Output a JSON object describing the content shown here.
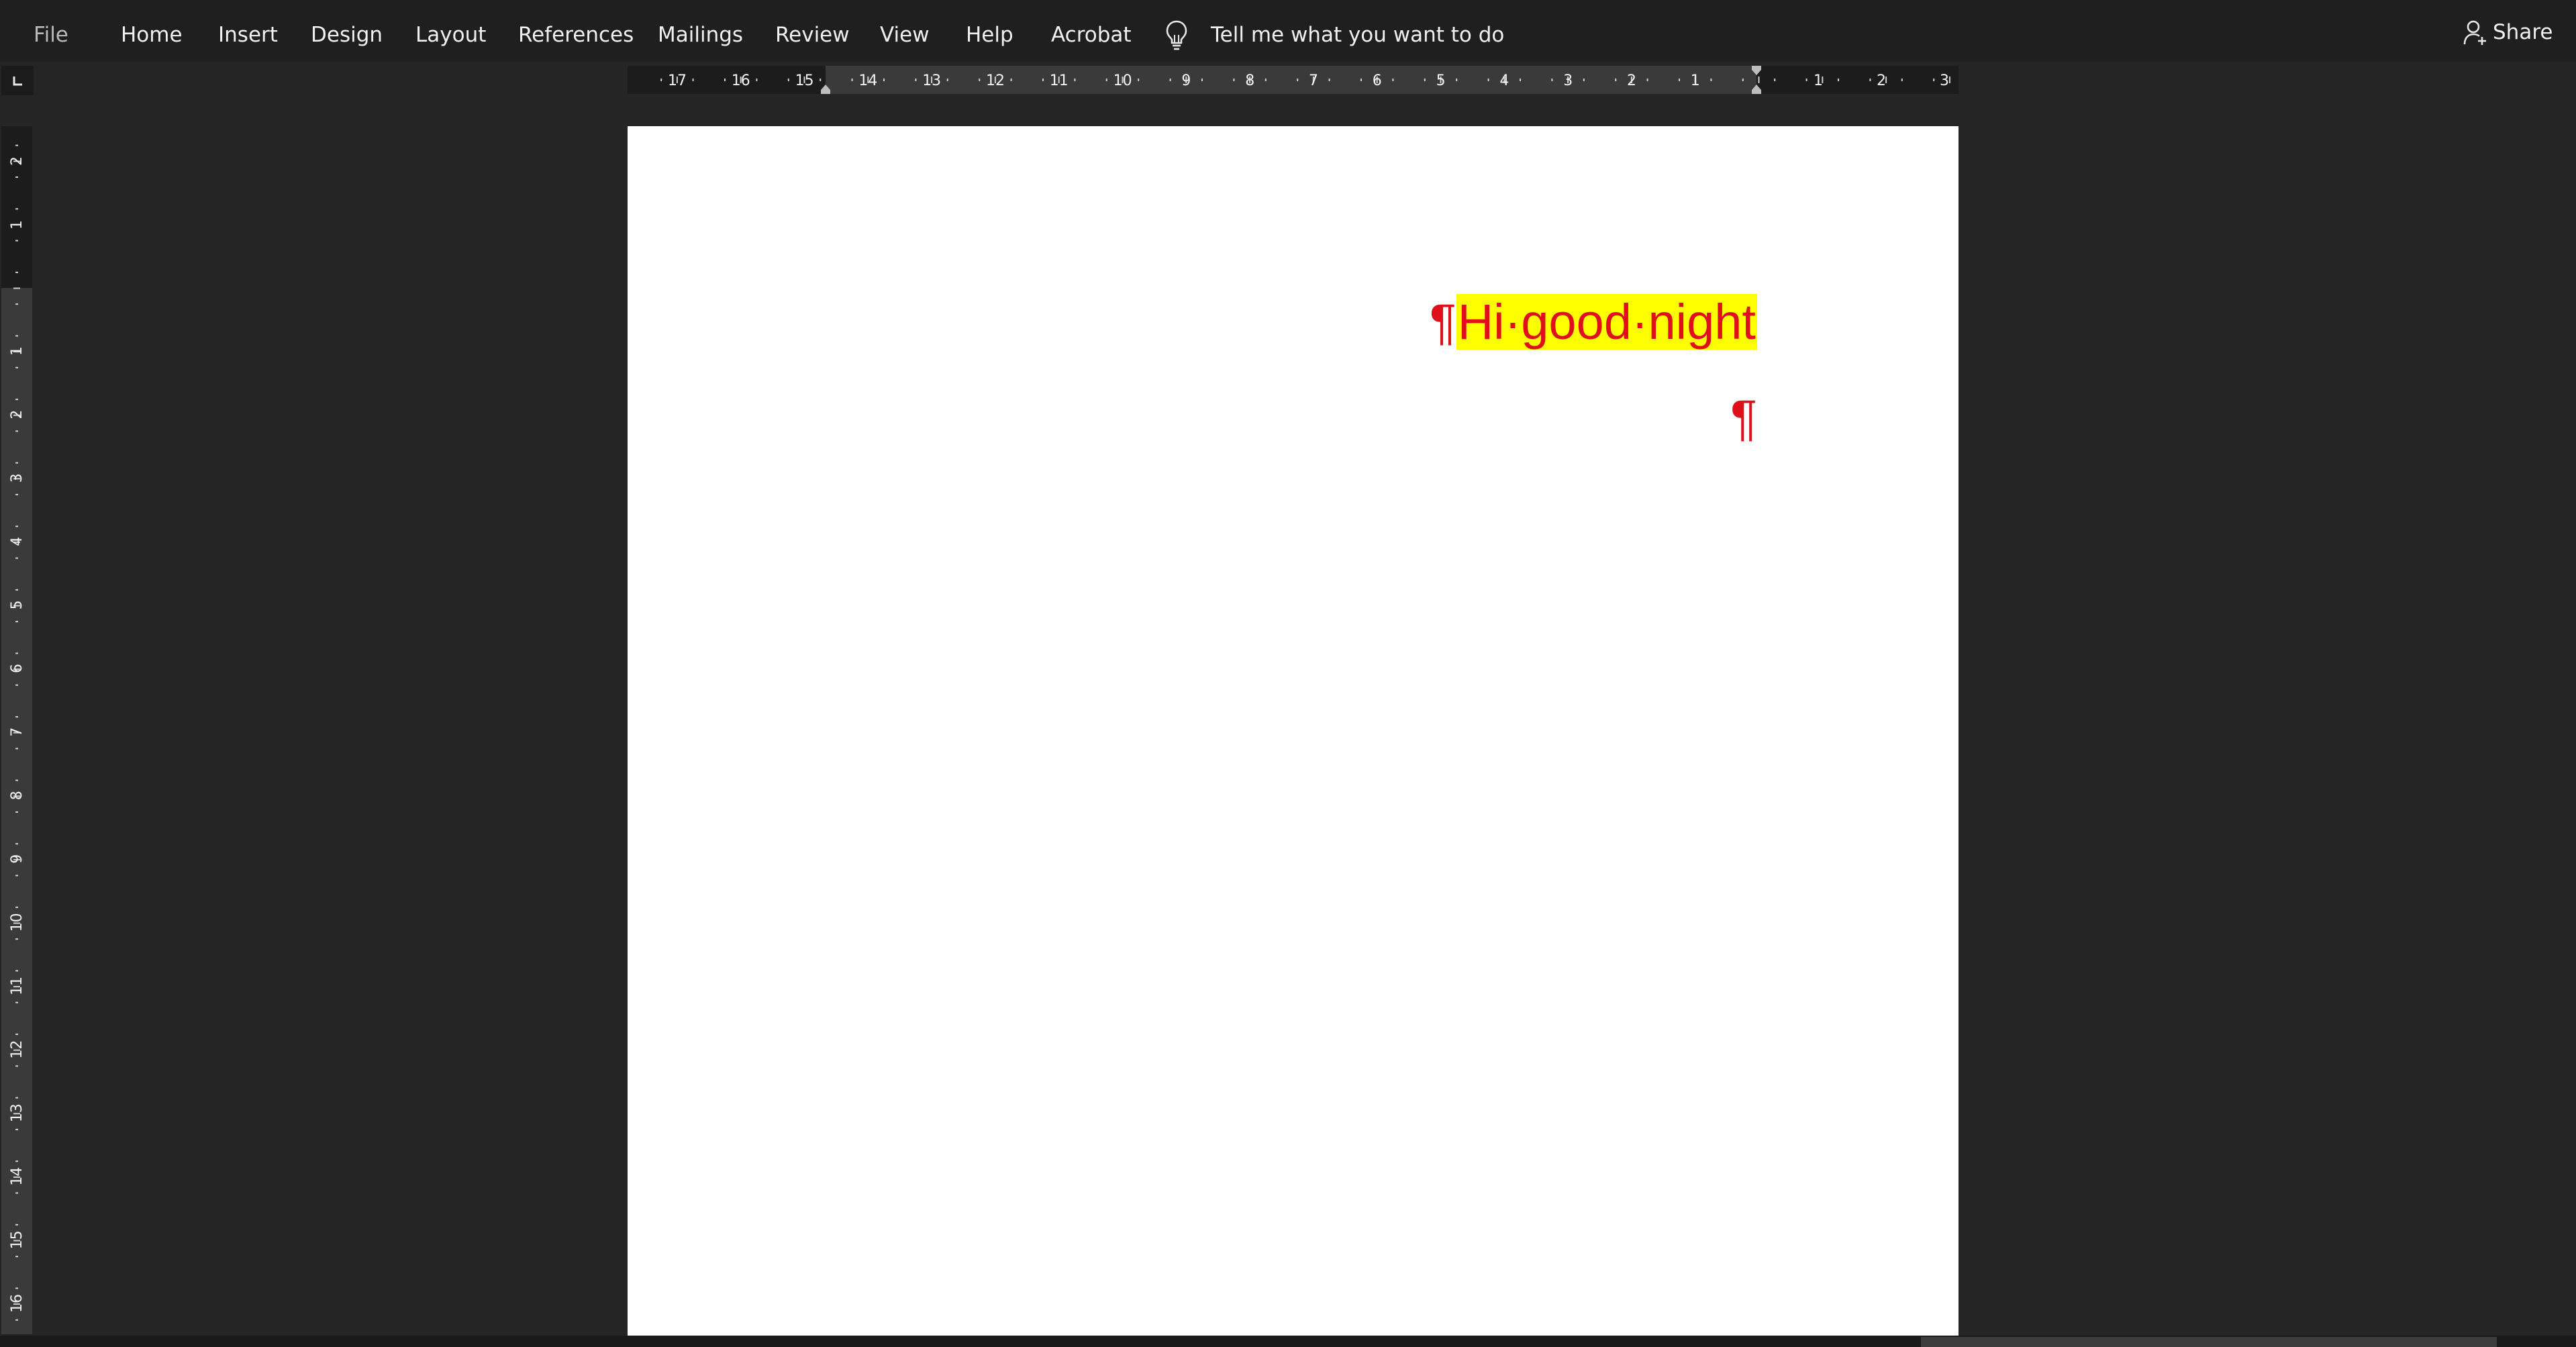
{
  "ribbon": {
    "tabs": [
      {
        "label": "File"
      },
      {
        "label": "Home"
      },
      {
        "label": "Insert"
      },
      {
        "label": "Design"
      },
      {
        "label": "Layout"
      },
      {
        "label": "References"
      },
      {
        "label": "Mailings"
      },
      {
        "label": "Review"
      },
      {
        "label": "View"
      },
      {
        "label": "Help"
      },
      {
        "label": "Acrobat"
      }
    ],
    "tell_me_icon": "lightbulb-icon",
    "tell_me": "Tell me what you want to do",
    "share_icon": "person-add-icon",
    "share_label": "Share"
  },
  "rulers": {
    "horizontal_labels": [
      "17",
      "16",
      "15",
      "14",
      "13",
      "12",
      "11",
      "10",
      "9",
      "8",
      "7",
      "6",
      "5",
      "4",
      "3",
      "2",
      "1",
      "1",
      "2",
      "3"
    ],
    "vertical_labels": [
      "2",
      "1",
      "1",
      "2",
      "3",
      "4",
      "5",
      "6",
      "7",
      "8",
      "9",
      "10",
      "11",
      "12",
      "13",
      "14",
      "15",
      "16"
    ]
  },
  "document": {
    "paragraphs": [
      {
        "pilcrow": "¶",
        "text": "Hi·good·night"
      },
      {
        "pilcrow": "¶",
        "text": ""
      }
    ],
    "text_color": "#e0101a",
    "highlight_color": "#ffff00"
  },
  "theme": {
    "background": "#252526",
    "ribbon": "#1f1f1f",
    "ruler": "#3a3a3a"
  }
}
